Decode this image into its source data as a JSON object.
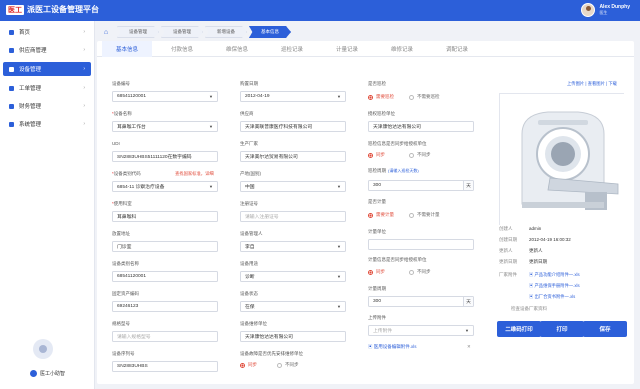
{
  "header": {
    "logo_mark": "医工",
    "title": "派医工设备管理平台",
    "user_name": "Alex Dunphy",
    "user_role": "医生"
  },
  "sidebar": {
    "items": [
      {
        "label": "首页"
      },
      {
        "label": "供应商管理"
      },
      {
        "label": "设备管理"
      },
      {
        "label": "工单管理"
      },
      {
        "label": "财务管理"
      },
      {
        "label": "系统管理"
      }
    ],
    "helper": "医工小助智"
  },
  "breadcrumb": [
    "设备管理",
    "设备管理",
    "新增设备",
    "基本信息"
  ],
  "tabs": [
    "基本信息",
    "付款信息",
    "维保信息",
    "巡检记录",
    "计量记录",
    "维修记录",
    "调配记录"
  ],
  "form": {
    "col1": [
      {
        "label": "设备编号",
        "value": "68541120001",
        "type": "select"
      },
      {
        "label": "设备名称",
        "required": true,
        "value": "耳鼻喉工作台",
        "type": "select"
      },
      {
        "label": "UDI",
        "value": "SN2883UHBS51111120在数字编码",
        "type": "text"
      },
      {
        "label": "设备类别代码",
        "required": true,
        "value": "6854-11 诊察治疗设备",
        "type": "select",
        "hint": "查找国家标准，详细"
      },
      {
        "label": "使用科室",
        "required": true,
        "value": "耳鼻喉科",
        "type": "text"
      },
      {
        "label": "放置地址",
        "value": "门诊室",
        "type": "text"
      },
      {
        "label": "设备类别名称",
        "value": "68541120001",
        "type": "text"
      },
      {
        "label": "固定资产编码",
        "value": "69246123",
        "type": "text"
      },
      {
        "label": "规格型号",
        "value": "请输入规格型号",
        "type": "placeholder"
      },
      {
        "label": "设备序列号",
        "value": "SN2883UHBS",
        "type": "text"
      }
    ],
    "col2": [
      {
        "label": "购置日期",
        "value": "2012-04-19",
        "type": "select"
      },
      {
        "label": "供应商",
        "value": "天津美联普康医疗科技有限公司",
        "type": "text"
      },
      {
        "label": "生产厂家",
        "value": "天津美尔达贸易有限公司",
        "type": "text"
      },
      {
        "label": "产地(国别)",
        "value": "中国",
        "type": "select"
      },
      {
        "label": "注册证号",
        "value": "请输入注册证号",
        "type": "placeholder"
      },
      {
        "label": "设备管理人",
        "value": "李自",
        "type": "select"
      },
      {
        "label": "设备用途",
        "value": "诊断",
        "type": "select"
      },
      {
        "label": "设备状态",
        "value": "在保",
        "type": "select"
      },
      {
        "label": "设备维修单位",
        "value": "天津康怡达达有限公司",
        "type": "text"
      },
      {
        "label": "设备故障是否优先安排维修单位",
        "type": "radio",
        "options": [
          "同步",
          "不同步"
        ],
        "selected": 0
      }
    ],
    "col3": [
      {
        "label": "是否巡检",
        "type": "radio",
        "options": [
          "需要巡检",
          "不需要巡检"
        ],
        "selected": 0
      },
      {
        "label": "授权巡检单位",
        "value": "天津康怡达达有限公司",
        "type": "text"
      },
      {
        "label": "巡检信息是否同步给授权单位",
        "type": "radio",
        "options": [
          "同步",
          "不同步"
        ],
        "selected": 0
      },
      {
        "label": "巡检周期",
        "note": "(请输入巡检天数)",
        "value": "300",
        "unit": "天",
        "type": "unit"
      },
      {
        "label": "是否计量",
        "type": "radio",
        "options": [
          "需要计量",
          "不需要计量"
        ],
        "selected": 0
      },
      {
        "label": "计量单位",
        "value": "",
        "type": "text"
      },
      {
        "label": "计量信息是否同步给授权单位",
        "type": "radio",
        "options": [
          "同步",
          "不同步"
        ],
        "selected": 0
      },
      {
        "label": "计量周期",
        "value": "300",
        "unit": "天",
        "type": "unit"
      },
      {
        "label": "上传附件",
        "value": "上传附件",
        "type": "placeholder-select"
      }
    ],
    "attachment": "医用设备编辑附件.xls"
  },
  "side_panel": {
    "top_links": "上传图片 | 查看图片 | 下载",
    "meta": [
      {
        "key": "创建人",
        "value": "admin"
      },
      {
        "key": "创建日期",
        "value": "2012-04-19 16:00:32"
      },
      {
        "key": "更新人",
        "value": "更新人"
      },
      {
        "key": "更新日期",
        "value": "更新日期"
      }
    ],
    "factory_label": "厂家附件",
    "files": [
      "产品功能介绍附件一.xls",
      "产品维保手册附件一.xls",
      "出厂合资书附件一.xls"
    ],
    "check_link": "检查设备厂家资料"
  },
  "buttons": {
    "qrcode": "二维码打印",
    "print": "打印",
    "save": "保存"
  },
  "colors": {
    "primary": "#2c5fd9",
    "accent_red": "#e04b3a"
  },
  "icons": [
    "home-icon",
    "supplier-icon",
    "device-icon",
    "workorder-icon",
    "finance-icon",
    "system-icon",
    "close-icon",
    "settings-icon"
  ]
}
